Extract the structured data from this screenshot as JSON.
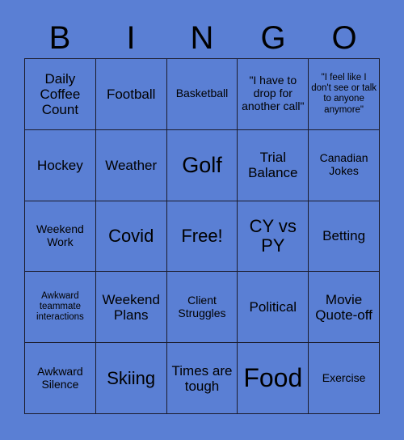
{
  "card": {
    "header_letters": [
      "B",
      "I",
      "N",
      "G",
      "O"
    ],
    "rows": [
      [
        {
          "text": "Daily Coffee Count",
          "size": "md"
        },
        {
          "text": "Football",
          "size": "md"
        },
        {
          "text": "Basketball",
          "size": "sm"
        },
        {
          "text": "\"I have to drop for another call\"",
          "size": "sm"
        },
        {
          "text": "\"I feel like I don't see or talk to anyone anymore\"",
          "size": "xs"
        }
      ],
      [
        {
          "text": "Hockey",
          "size": "md"
        },
        {
          "text": "Weather",
          "size": "md"
        },
        {
          "text": "Golf",
          "size": "xl"
        },
        {
          "text": "Trial Balance",
          "size": "md"
        },
        {
          "text": "Canadian Jokes",
          "size": "sm"
        }
      ],
      [
        {
          "text": "Weekend Work",
          "size": "sm"
        },
        {
          "text": "Covid",
          "size": "lg"
        },
        {
          "text": "Free!",
          "size": "lg"
        },
        {
          "text": "CY vs PY",
          "size": "lg"
        },
        {
          "text": "Betting",
          "size": "md"
        }
      ],
      [
        {
          "text": "Awkward teammate interactions",
          "size": "xs"
        },
        {
          "text": "Weekend Plans",
          "size": "md"
        },
        {
          "text": "Client Struggles",
          "size": "sm"
        },
        {
          "text": "Political",
          "size": "md"
        },
        {
          "text": "Movie Quote-off",
          "size": "md"
        }
      ],
      [
        {
          "text": "Awkward Silence",
          "size": "sm"
        },
        {
          "text": "Skiing",
          "size": "lg"
        },
        {
          "text": "Times are tough",
          "size": "md"
        },
        {
          "text": "Food",
          "size": "xxl"
        },
        {
          "text": "Exercise",
          "size": "sm"
        }
      ]
    ]
  },
  "colors": {
    "background": "#5A7FD4",
    "text": "#000000",
    "grid_line": "#1b1b2b"
  }
}
